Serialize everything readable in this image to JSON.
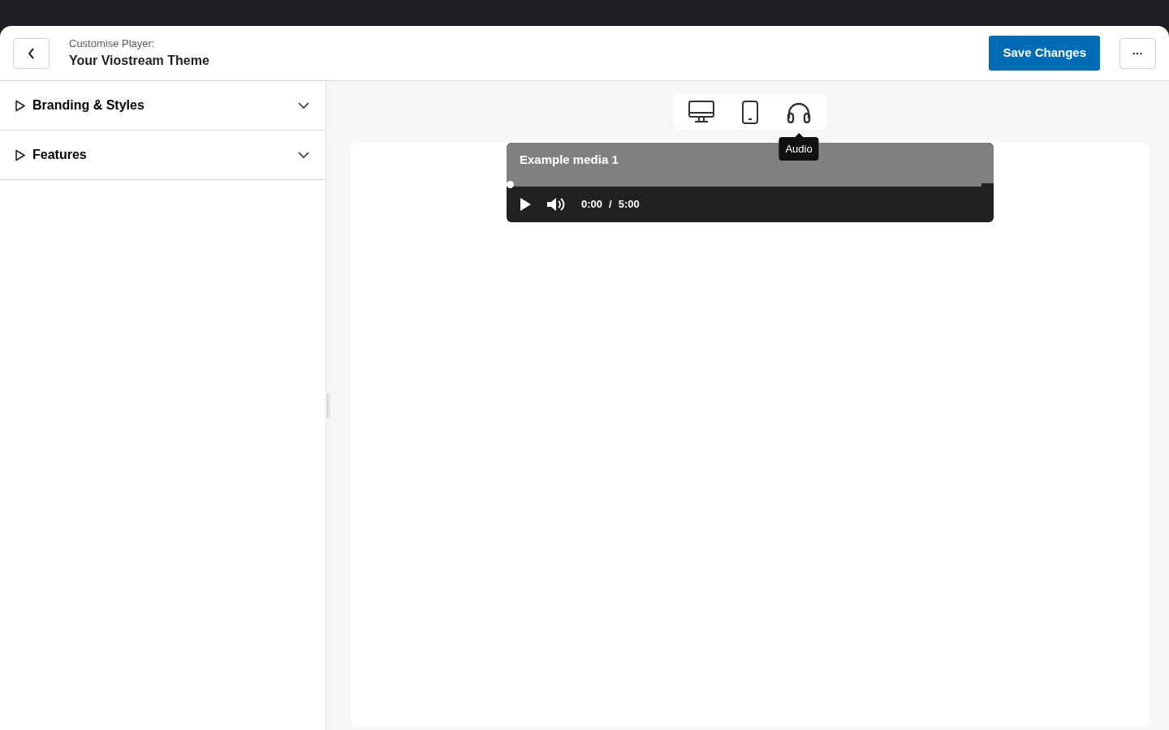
{
  "header": {
    "subtitle": "Customise Player:",
    "title": "Your Viostream Theme",
    "save_label": "Save Changes",
    "more_label": "···"
  },
  "sidebar": {
    "sections": [
      {
        "label": "Branding & Styles",
        "expanded": false
      },
      {
        "label": "Features",
        "expanded": false
      }
    ]
  },
  "devices": [
    {
      "kind": "desktop"
    },
    {
      "kind": "mobile"
    },
    {
      "kind": "audio",
      "tooltip": "Audio"
    }
  ],
  "player": {
    "title": "Example media 1",
    "level": 0,
    "current": "0:00",
    "separator": "/",
    "duration": "5:00"
  }
}
